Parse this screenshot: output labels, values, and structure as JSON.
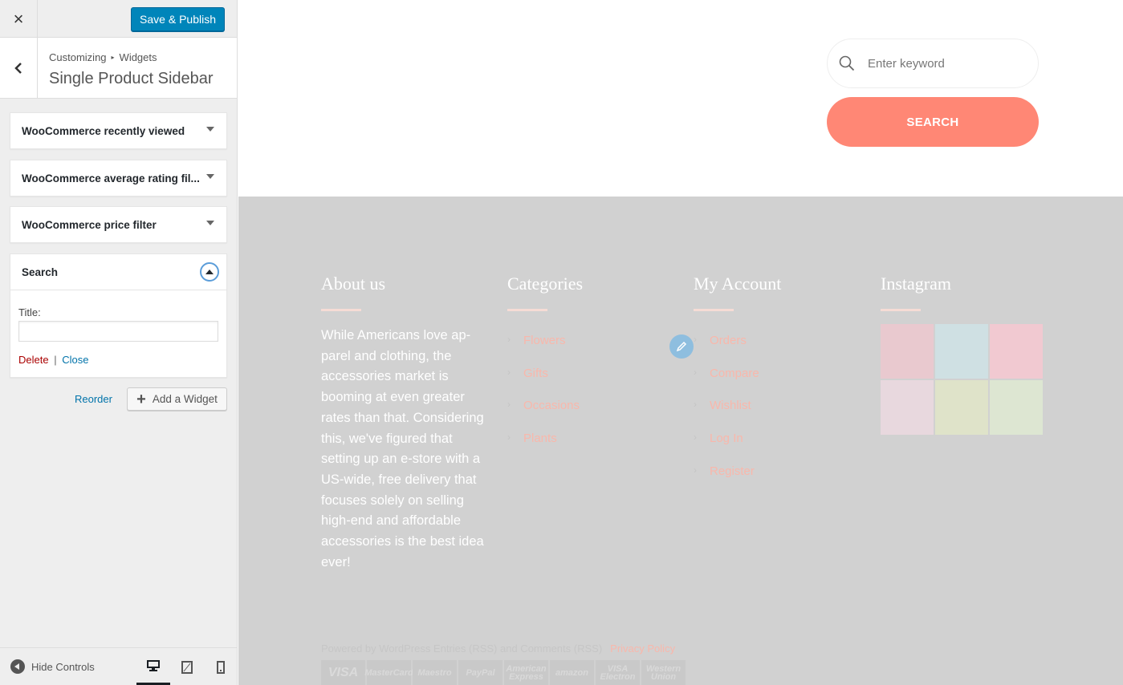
{
  "customizer": {
    "close_label": "×",
    "publish_label": "Save & Publish",
    "breadcrumb": {
      "root": "Customizing",
      "separator": "▸",
      "current": "Widgets"
    },
    "section_title": "Single Product Sidebar",
    "widgets": [
      {
        "label": "WooCommerce recently viewed"
      },
      {
        "label": "WooCommerce average rating fil..."
      },
      {
        "label": "WooCommerce price filter"
      },
      {
        "label": "Search"
      }
    ],
    "search_widget": {
      "title_label": "Title:",
      "title_value": "",
      "delete_label": "Delete",
      "separator": "|",
      "close_label": "Close"
    },
    "reorder_label": "Reorder",
    "add_widget_label": "Add a Widget",
    "hide_controls_label": "Hide Controls",
    "devices": [
      "desktop",
      "tablet",
      "mobile"
    ],
    "active_device": "desktop"
  },
  "preview": {
    "search": {
      "placeholder": "Enter keyword",
      "submit_label": "SEARCH"
    },
    "footer": {
      "about": {
        "title": "About us",
        "text": "While Americans love ap­parel and clothing, the accessories market is booming at even greater rates than that. Consider­ing this, we've figured that setting up an e-store with a US-wide, free deliv­ery that focuses solely on selling high-end and af­fordable accessories is the best idea ever!"
      },
      "categories": {
        "title": "Categories",
        "items": [
          "Flowers",
          "Gifts",
          "Occasions",
          "Plants"
        ]
      },
      "account": {
        "title": "My Account",
        "items": [
          "Orders",
          "Compare",
          "Wishlist",
          "Log In",
          "Register"
        ]
      },
      "instagram": {
        "title": "Instagram",
        "tile_colors": [
          "#e9c9cf",
          "#cfe0e3",
          "#f1c9d1",
          "#e8d8de",
          "#dfe3c9",
          "#dde6d2"
        ]
      },
      "copyright": "Powered by WordPress Entries (RSS) and Comments (RSS)",
      "privacy_label": "Privacy Policy",
      "payments": [
        "VISA",
        "MasterCard",
        "Maestro",
        "PayPal",
        "American Express",
        "amazon",
        "VISA Electron",
        "Western Union"
      ]
    }
  },
  "colors": {
    "primary": "#0085ba",
    "accent": "#ff8775",
    "footer_bg": "#d1d1d1",
    "link_pink": "#f9b7ab"
  }
}
